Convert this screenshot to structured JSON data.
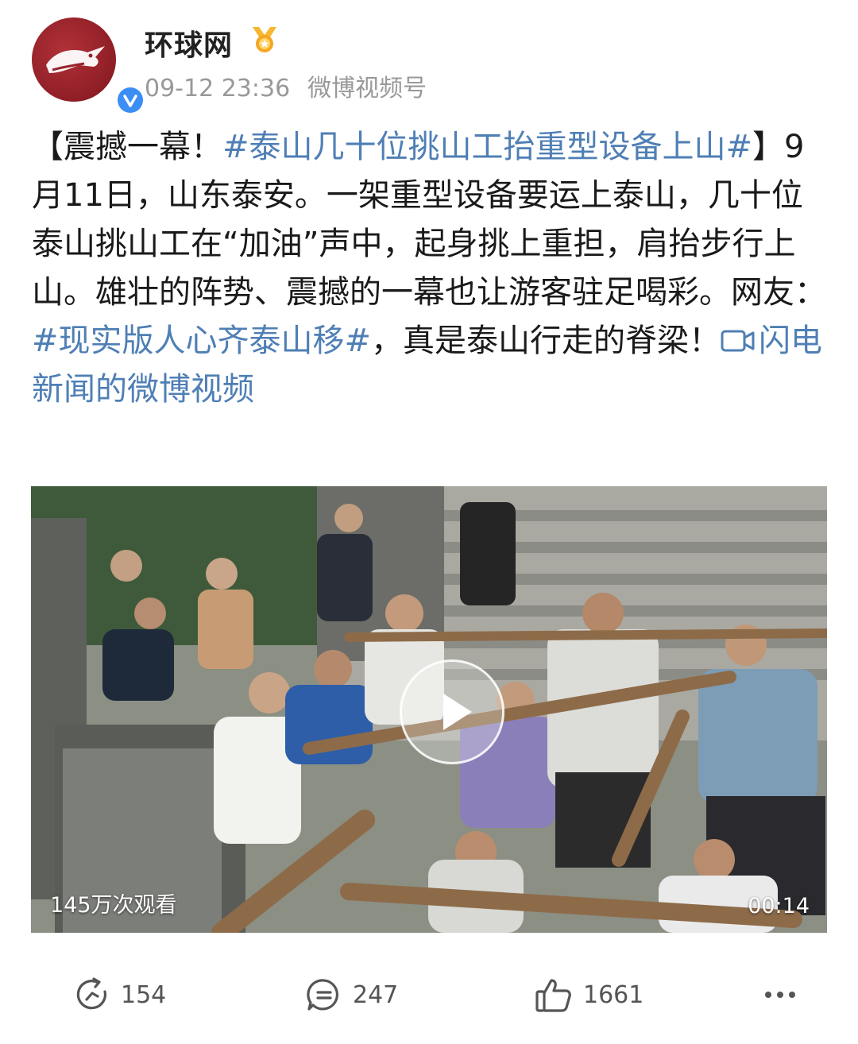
{
  "header": {
    "username": "环球网",
    "timestamp": "09-12 23:36",
    "source": "微博视频号",
    "avatar_color": "#9a232b",
    "verified_color": "#3a8ef6",
    "vip_color": "#f5a623"
  },
  "post": {
    "bracket_open": "【",
    "headline": "震撼一幕！",
    "headline_tag": "#泰山几十位挑山工抬重型设备上山#",
    "bracket_close": "】",
    "body_1": "9月11日，山东泰安。一架重型设备要运上泰山，几十位泰山挑山工在“加油”声中，起身挑上重担，肩抬步行上山。雄壮的阵势、震撼的一幕也让游客驻足喝彩。网友：",
    "body_tag": "#现实版人心齐泰山移#",
    "body_2": "，真是泰山行走的脊梁！",
    "video_link": "闪电新闻的微博视频",
    "link_color": "#4f7fb5"
  },
  "video": {
    "view_count": "145万次观看",
    "duration": "00:14",
    "play_icon": "play-icon"
  },
  "actions": {
    "repost_count": "154",
    "comment_count": "247",
    "like_count": "1661",
    "repost_icon": "repost-icon",
    "comment_icon": "comment-icon",
    "like_icon": "thumbs-up-icon",
    "more_icon": "more-icon"
  }
}
